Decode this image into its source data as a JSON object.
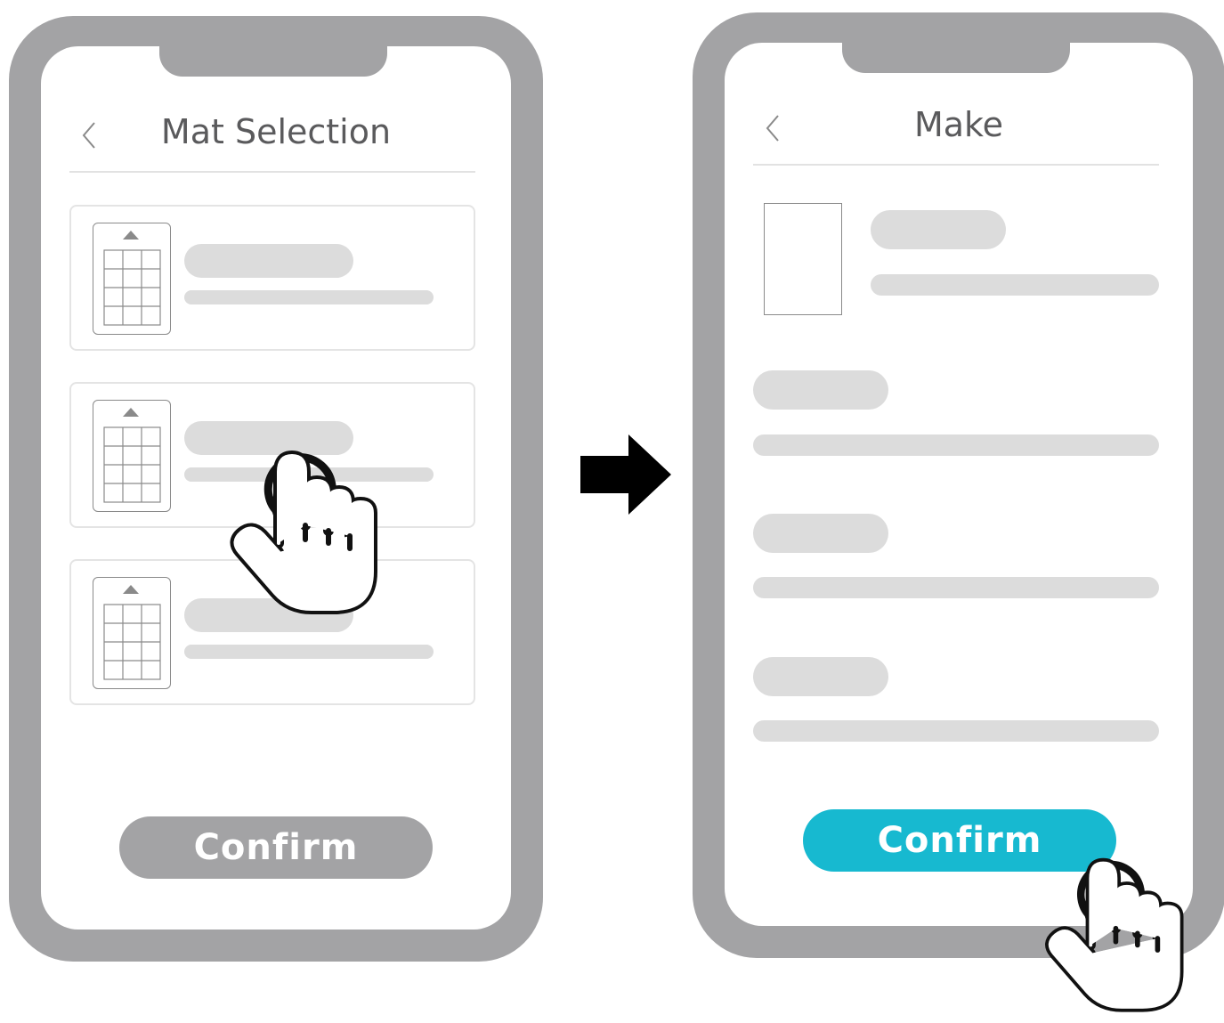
{
  "left_screen": {
    "title": "Mat Selection",
    "confirm_label": "Confirm",
    "confirm_state": "disabled",
    "mat_options": [
      {
        "icon": "mat-grid-icon"
      },
      {
        "icon": "mat-grid-icon"
      },
      {
        "icon": "mat-grid-icon"
      }
    ]
  },
  "right_screen": {
    "title": "Make",
    "confirm_label": "Confirm",
    "confirm_state": "enabled"
  },
  "colors": {
    "phone_frame": "#a3a3a5",
    "disabled_button": "#a3a3a5",
    "accent_button": "#17b9d0",
    "placeholder": "#dcdcdc"
  },
  "icons": {
    "back": "chevron-left-icon",
    "transition": "arrow-right-icon",
    "tap": "tap-hand-icon"
  }
}
